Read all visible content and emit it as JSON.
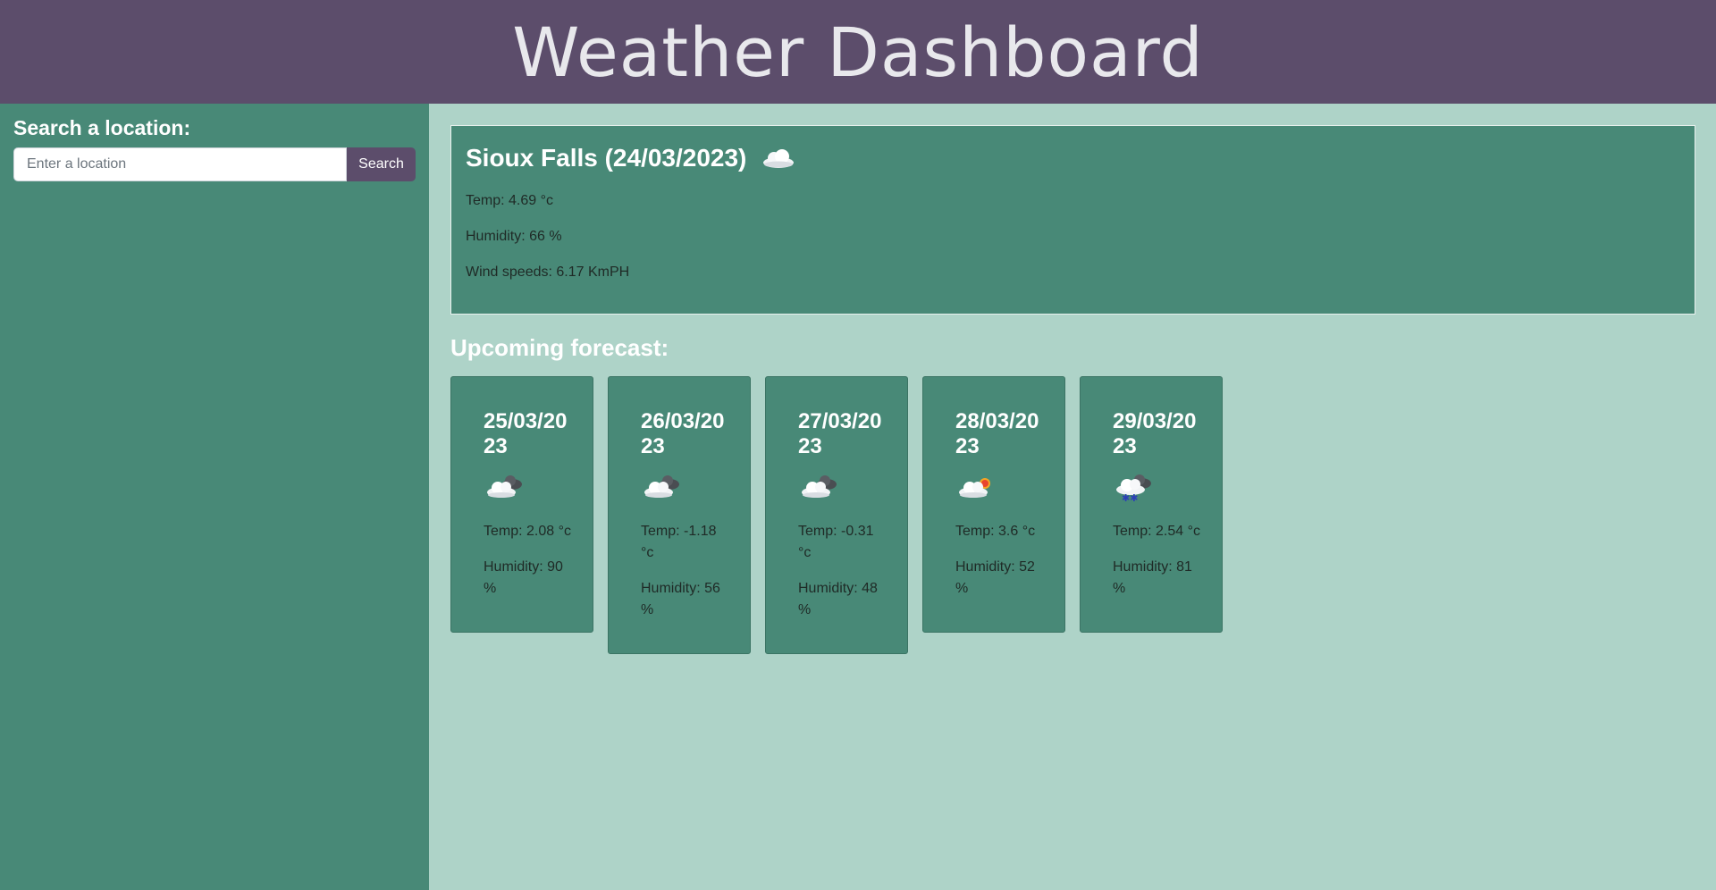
{
  "header": {
    "title": "Weather Dashboard"
  },
  "sidebar": {
    "heading": "Search a location:",
    "search": {
      "placeholder": "Enter a location",
      "value": "",
      "button_label": "Search"
    }
  },
  "current": {
    "title": "Sioux Falls (24/03/2023)",
    "icon": "cloud-icon",
    "temp": "Temp: 4.69 °c",
    "humidity": "Humidity: 66 %",
    "wind": "Wind speeds: 6.17 KmPH"
  },
  "forecast": {
    "heading": "Upcoming forecast:",
    "days": [
      {
        "date": "25/03/2023",
        "icon": "broken-clouds-icon",
        "temp": "Temp: 2.08 °c",
        "humidity": "Humidity: 90 %"
      },
      {
        "date": "26/03/2023",
        "icon": "broken-clouds-icon",
        "temp": "Temp: -1.18 °c",
        "humidity": "Humidity: 56 %"
      },
      {
        "date": "27/03/2023",
        "icon": "broken-clouds-icon",
        "temp": "Temp: -0.31 °c",
        "humidity": "Humidity: 48 %"
      },
      {
        "date": "28/03/2023",
        "icon": "few-clouds-icon",
        "temp": "Temp: 3.6 °c",
        "humidity": "Humidity: 52 %"
      },
      {
        "date": "29/03/2023",
        "icon": "snow-icon",
        "temp": "Temp: 2.54 °c",
        "humidity": "Humidity: 81 %"
      }
    ]
  },
  "colors": {
    "header_bg": "#5c4d6b",
    "sidebar_bg": "#488977",
    "main_bg": "#aed3c8",
    "card_bg": "#488977",
    "button_bg": "#5c4d6b"
  }
}
